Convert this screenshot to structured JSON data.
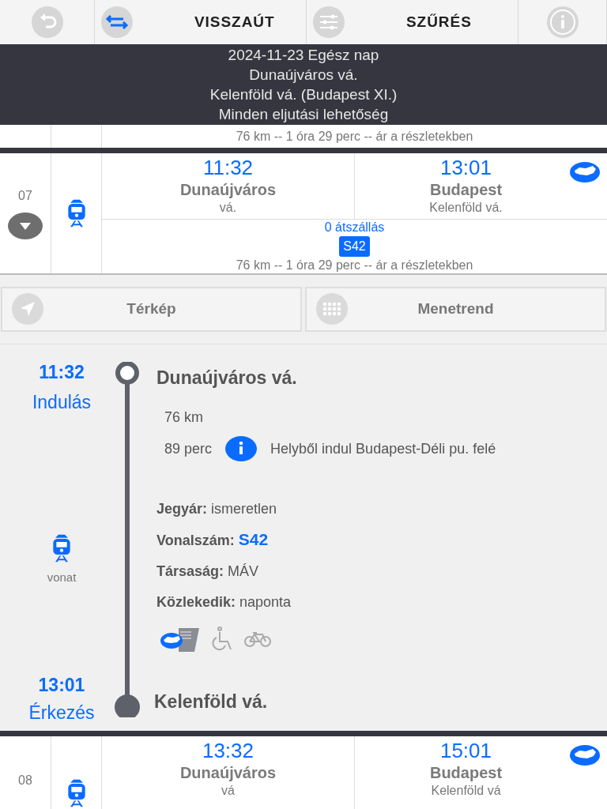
{
  "toolbar": {
    "buttons": [
      {
        "kind": "back"
      },
      {
        "kind": "swap",
        "label": "VISSZAÚT"
      },
      {
        "kind": "filter",
        "label": "SZŰRÉS"
      },
      {
        "kind": "info"
      }
    ]
  },
  "header": {
    "lines": [
      "2024-11-23 Egész nap",
      "Dunaújváros vá.",
      "Kelenföld vá. (Budapest XI.)",
      "Minden eljutási lehetőség"
    ]
  },
  "previous_row": {
    "summary": "76 km -- 1 óra 29 perc -- ár a részletekben"
  },
  "results": [
    {
      "number": "07",
      "expanded": true,
      "depart_time": "11:32",
      "depart_station": "Dunaújváros",
      "depart_sub": "vá.",
      "arrive_time": "13:01",
      "arrive_station": "Budapest",
      "arrive_sub": "Kelenföld vá.",
      "transfers": "0 átszállás",
      "line": "S42",
      "summary": "76 km -- 1 óra 29 perc -- ár a részletekben"
    }
  ],
  "detail_tabs": [
    {
      "kind": "map",
      "label": "Térkép"
    },
    {
      "kind": "timetable",
      "label": "Menetrend"
    }
  ],
  "detail": {
    "depart_time": "11:32",
    "depart_label": "Indulás",
    "depart_station": "Dunaújváros vá.",
    "distance": "76 km",
    "duration": "89 perc",
    "note": "Helyből indul Budapest-Déli pu. felé",
    "mode": "vonat",
    "facts": [
      {
        "label": "Jegyár:",
        "value": "ismeretlen",
        "kind": "plain"
      },
      {
        "label": "Vonalszám:",
        "value": "S42",
        "kind": "link"
      },
      {
        "label": "Társaság:",
        "value": "MÁV",
        "kind": "plain"
      },
      {
        "label": "Közlekedik:",
        "value": "naponta",
        "kind": "plain"
      }
    ],
    "arrive_time": "13:01",
    "arrive_label": "Érkezés",
    "arrive_station": "Kelenföld vá."
  },
  "next_row": {
    "number": "08",
    "depart_time": "13:32",
    "depart_station": "Dunaújváros",
    "depart_sub": "vá",
    "arrive_time": "15:01",
    "arrive_station": "Budapest",
    "arrive_sub": "Kelenföld vá"
  }
}
